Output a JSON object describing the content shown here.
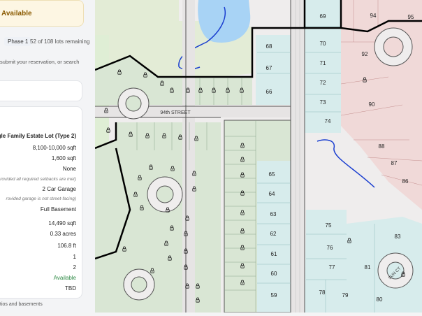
{
  "panel": {
    "banner": "Available",
    "phase_label": "Phase 1",
    "lots_remaining": "52 of 108 lots remaining",
    "instructions": "submit your reservation, or search",
    "lot_type": "ngle Family Estate Lot (Type 2)",
    "home_size": "8,100-10,000 sqft",
    "min_size": "1,600 sqft",
    "restriction": "None",
    "setback_note": "rovided all required setbacks are met)",
    "garage": "2 Car Garage",
    "garage_note": "rovided garage is not street-facing)",
    "basement": "Full Basement",
    "lot_sqft": "14,490 sqft",
    "acres": "0.33 acres",
    "frontage": "106.8 ft",
    "val1": "1",
    "val2": "2",
    "status": "Available",
    "price": "TBD",
    "footer": "tios and basements"
  },
  "map": {
    "street1": "94th STREET",
    "street2": "SUN CT",
    "lots_right": [
      "69",
      "70",
      "71",
      "72",
      "73",
      "74",
      "68",
      "67",
      "66",
      "65",
      "64",
      "63",
      "62",
      "61",
      "60",
      "59"
    ],
    "lots_left": [
      "75",
      "76",
      "77",
      "78",
      "79",
      "80",
      "81",
      "83"
    ],
    "lots_reserved": [
      "94",
      "95",
      "92",
      "90",
      "88",
      "87",
      "86"
    ]
  },
  "colors": {
    "lot_green": "#d9e6d4",
    "lot_teal": "#d7ecec",
    "lot_pink": "#f0d9d8",
    "available_text": "#2e8a45",
    "banner_bg": "#fdf6e3"
  }
}
